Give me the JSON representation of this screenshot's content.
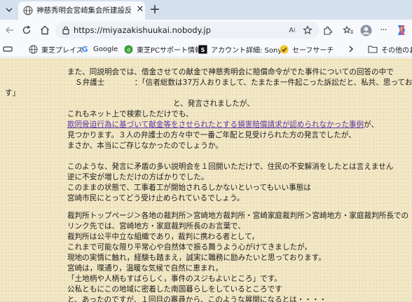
{
  "browser": {
    "tab": {
      "title": "神慈秀明会宮崎集会所建設反対",
      "favicon": "globe-icon"
    },
    "address": {
      "url": "https://miyazakishuukai.nobody.jp"
    },
    "bookmarks": [
      {
        "label": "東芝プレイス",
        "icon": "globe-icon"
      },
      {
        "label": "Google",
        "icon": "google-icon"
      },
      {
        "label": "東芝PCサポート情報",
        "icon": "dyna-icon"
      },
      {
        "label": "アカウント詳細: Sony...",
        "icon": "sony-icon"
      },
      {
        "label": "セーフサーチ",
        "icon": "check-icon"
      },
      {
        "label": "その他のお",
        "icon": "folder-icon"
      }
    ]
  },
  "content": {
    "p1": [
      "また、同説明会では、借金させての献金で神慈秀明会に賠償命令がでた事件についての回答の中で",
      "Ｓ弁護士　　　　：「信者総数は37万人おりまして、たまたま一件起こった訴訟だと、私共、思っておりま",
      "す」",
      "と、発言されましたが、",
      "これもネット上で検索しただけでも、",
      "欺罔脅迫行為に基づいて献金等をさせられたとする損害賠償請求が認められなかった事例",
      "が、",
      "見つかります。３人の弁護士の方々中で一番ご年配と見受けられた方の発言でしたが、",
      "まさか、本当にご存じなかったのでしょうか。"
    ],
    "p2": [
      "このような、発言に矛盾の多い説明会を１回開いただけで、住民の不安解消をしたとは言えません",
      "逆に不安が増しただけの方ばかりでした。",
      "このままの状態で、工事着工が開始されるしかないといってもいい事態は",
      "宮崎市民にとってどう受け止められているでしょう。"
    ],
    "p3": [
      "裁判所トップページ＞各地の裁判所＞宮崎地方裁判所・宮崎家庭裁判所＞宮崎地方・家庭裁判所長での",
      "リンク先では、宮崎地方・家庭裁判所長のお言葉で、",
      "裁判所は公平中立な組織であり，裁判に携わる者として，",
      "これまで可能な限り平常心や自然体で振る舞うよう心がけてきましたが，",
      "現地の実情に触れ，経験も踏まえ，誠実に職務に励みたいと思っております。",
      "宮崎は，喋通り，温暖な気候で自然に恵まれ，",
      "「土地柄や人柄もすばらしく，事件のスジもよいところ」です。",
      "公私ともにこの地域に密着した南国暮らしをしているところです",
      "と、あったのですが、１回目の審尋から、このような展開になるとは・・・・"
    ]
  }
}
